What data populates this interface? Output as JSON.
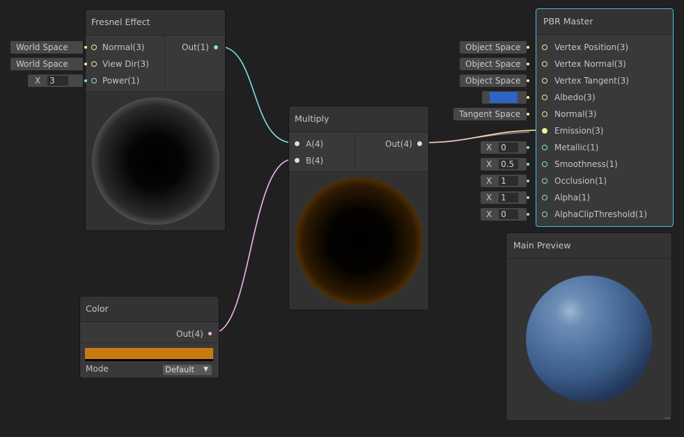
{
  "fresnel": {
    "title": "Fresnel Effect",
    "inputs": [
      "Normal(3)",
      "View Dir(3)",
      "Power(1)"
    ],
    "output": "Out(1)",
    "normal_space": "World Space",
    "viewdir_space": "World Space",
    "power_axis": "X",
    "power_value": "3"
  },
  "multiply": {
    "title": "Multiply",
    "inputs": [
      "A(4)",
      "B(4)"
    ],
    "output": "Out(4)"
  },
  "color_node": {
    "title": "Color",
    "output": "Out(4)",
    "swatch": "#c77a12",
    "mode_label": "Mode",
    "mode_value": "Default"
  },
  "pbr": {
    "title": "PBR Master",
    "ports": [
      {
        "label": "Vertex Position(3)",
        "value": "Object Space"
      },
      {
        "label": "Vertex Normal(3)",
        "value": "Object Space"
      },
      {
        "label": "Vertex Tangent(3)",
        "value": "Object Space"
      },
      {
        "label": "Albedo(3)",
        "value": "",
        "swatch": "#2f63c4"
      },
      {
        "label": "Normal(3)",
        "value": "Tangent Space"
      },
      {
        "label": "Emission(3)",
        "value": ""
      },
      {
        "label": "Metallic(1)",
        "axis": "X",
        "value": "0"
      },
      {
        "label": "Smoothness(1)",
        "axis": "X",
        "value": "0.5"
      },
      {
        "label": "Occlusion(1)",
        "axis": "X",
        "value": "1"
      },
      {
        "label": "Alpha(1)",
        "axis": "X",
        "value": "1"
      },
      {
        "label": "AlphaClipThreshold(1)",
        "axis": "X",
        "value": "0"
      }
    ]
  },
  "main_preview": {
    "title": "Main Preview"
  },
  "colors": {
    "vector3": "#f6ee9a",
    "vector1": "#84e0e8",
    "vector4": "#f1b6ec",
    "selection": "#44c0ec"
  }
}
